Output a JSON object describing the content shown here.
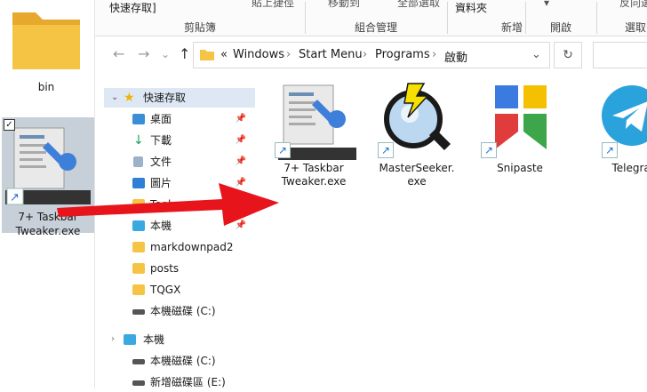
{
  "desktop": {
    "bin_label": "bin",
    "tweaker_label_line1": "7+ Taskbar",
    "tweaker_label_line2": "Tweaker.exe"
  },
  "ribbon": {
    "quick_access": "快速存取]",
    "paste_shortcut": "貼上捷徑",
    "move_to": "移動到",
    "select_all": "全部選取",
    "new_folder": "資料夾",
    "invert": "反向選",
    "group_clipboard": "剪貼簿",
    "group_organize": "組合管理",
    "group_new": "新增",
    "group_open": "開啟",
    "group_select": "選取"
  },
  "address": {
    "chevrons": "«",
    "crumb1": "Windows",
    "crumb2": "Start Menu",
    "crumb3": "Programs",
    "crumb4": "啟動"
  },
  "sidebar": {
    "quick_access": "快速存取",
    "items": [
      "桌面",
      "下載",
      "文件",
      "圖片",
      "Tools",
      "本機",
      "markdownpad2",
      "posts",
      "TQGX",
      "本機磁碟 (C:)"
    ],
    "this_pc": "本機",
    "drives": [
      "本機磁碟 (C:)",
      "新增磁碟區 (E:)"
    ]
  },
  "files": [
    {
      "line1": "7+ Taskbar",
      "line2": "Tweaker.exe"
    },
    {
      "line1": "MasterSeeker.",
      "line2": "exe"
    },
    {
      "line1": "Snipaste",
      "line2": ""
    },
    {
      "line1": "Telegram",
      "line2": ""
    }
  ],
  "colors": {
    "arrow": "#e8141b",
    "folder": "#f6c445",
    "selection": "#c7cfd8",
    "sidebar_selection": "#dde8f4",
    "telegram": "#2aa3dc"
  }
}
